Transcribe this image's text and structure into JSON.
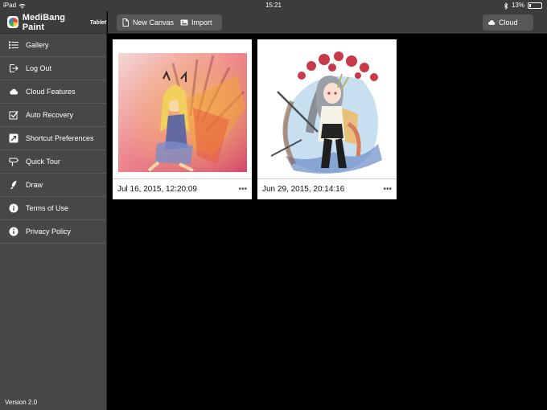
{
  "status_bar": {
    "device": "iPad",
    "time": "15:21",
    "battery": "13%",
    "battery_level": 0.13
  },
  "sidebar": {
    "brand": "MediBang Paint",
    "brand_sub": "Tablet",
    "items": [
      {
        "label": "Gallery",
        "icon": "list-icon"
      },
      {
        "label": "Log Out",
        "icon": "logout-icon"
      },
      {
        "label": "Cloud Features",
        "icon": "cloud-icon"
      },
      {
        "label": "Auto Recovery",
        "icon": "checkbox-icon"
      },
      {
        "label": "Shortcut Preferences",
        "icon": "shortcut-icon"
      },
      {
        "label": "Quick Tour",
        "icon": "signpost-icon"
      },
      {
        "label": "Draw",
        "icon": "brush-icon"
      },
      {
        "label": "Terms of Use",
        "icon": "info-icon"
      },
      {
        "label": "Privacy Policy",
        "icon": "info-icon"
      }
    ],
    "version": "Version 2.0"
  },
  "toolbar": {
    "new_canvas": "New Canvas",
    "import": "Import",
    "cloud": "Cloud"
  },
  "gallery": {
    "items": [
      {
        "date": "Jul 16, 2015, 12:20:09",
        "more": "•••"
      },
      {
        "date": "Jun 29, 2015, 20:14:16",
        "more": "•••"
      }
    ]
  },
  "colors": {
    "sidebar_bg": "#474747",
    "toolbar_bg": "#3c3c3c",
    "button_bg": "#575757",
    "canvas_bg": "#000000"
  }
}
